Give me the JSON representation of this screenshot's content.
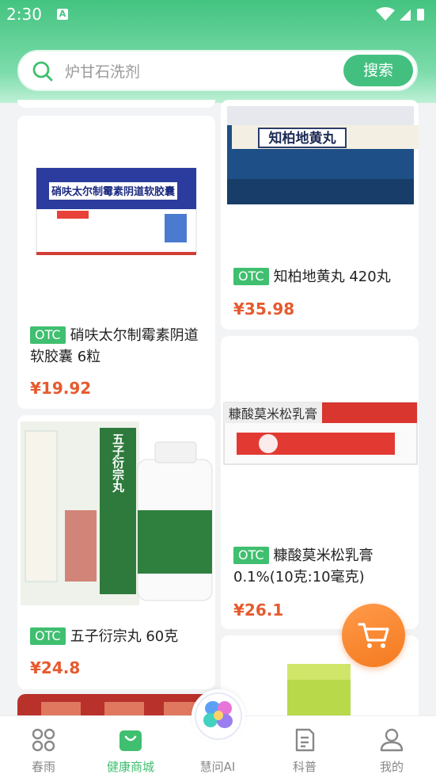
{
  "status_bar": {
    "time": "2:30",
    "notif_badge": "A"
  },
  "search": {
    "placeholder": "炉甘石洗剂",
    "button_label": "搜索"
  },
  "products": [
    {
      "otc": "OTC",
      "name": "硝呋太尔制霉素阴道软胶囊 6粒",
      "price": "¥19.92",
      "image_text": "硝呋太尔制霉素阴道软胶囊"
    },
    {
      "otc": "OTC",
      "name": "知柏地黄丸 420丸",
      "price": "¥35.98",
      "image_text": "知柏地黄丸"
    },
    {
      "otc": "OTC",
      "name": "五子衍宗丸 60克",
      "price": "¥24.8",
      "image_text": "五子衍宗丸"
    },
    {
      "otc": "OTC",
      "name": "糠酸莫米松乳膏 0.1%(10克:10毫克)",
      "price": "¥26.1",
      "image_text": "糠酸莫米松乳膏"
    }
  ],
  "tabs": [
    {
      "label": "春雨",
      "icon": "apps-icon"
    },
    {
      "label": "健康商城",
      "icon": "shopping-bag-icon",
      "active": true
    },
    {
      "label": "慧问AI",
      "icon": "ai-flower-icon"
    },
    {
      "label": "科普",
      "icon": "article-icon"
    },
    {
      "label": "我的",
      "icon": "profile-icon"
    }
  ],
  "colors": {
    "brand_green": "#43c080",
    "price_red": "#e65a2e",
    "otc_green": "#3fbf6f",
    "cart_orange": "#f47a1f"
  }
}
